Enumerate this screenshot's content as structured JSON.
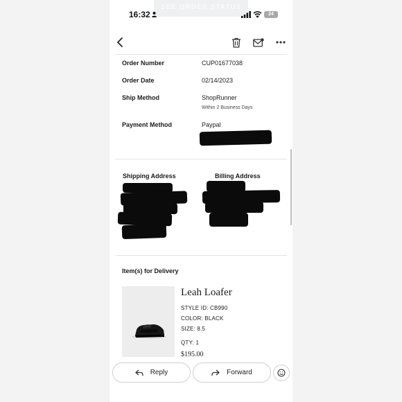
{
  "status_bar": {
    "time": "16:32",
    "battery": "24",
    "ghost_banner": "SEE ORDER STATUS"
  },
  "toolbar": {
    "back_icon": "chevron-left-icon",
    "trash_icon": "trash-icon",
    "mail_icon": "mail-unread-icon",
    "more_icon": "more-horizontal-icon"
  },
  "order": {
    "number_label": "Order Number",
    "number_value": "CUP01677038",
    "date_label": "Order Date",
    "date_value": "02/14/2023",
    "ship_label": "Ship Method",
    "ship_value": "ShopRunner",
    "ship_sub": "Within 2 Business Days",
    "payment_label": "Payment Method",
    "payment_value": "Paypal"
  },
  "addresses": {
    "shipping_title": "Shipping Address",
    "billing_title": "Billing Address"
  },
  "items": {
    "title": "Item(s) for Delivery",
    "product": {
      "name": "Leah Loafer",
      "style": "STYLE ID: CB990",
      "color": "COLOR: BLACK",
      "size": "SIZE: 8.5",
      "qty": "QTY: 1",
      "price": "$195.00"
    }
  },
  "actions": {
    "reply": "Reply",
    "forward": "Forward"
  }
}
